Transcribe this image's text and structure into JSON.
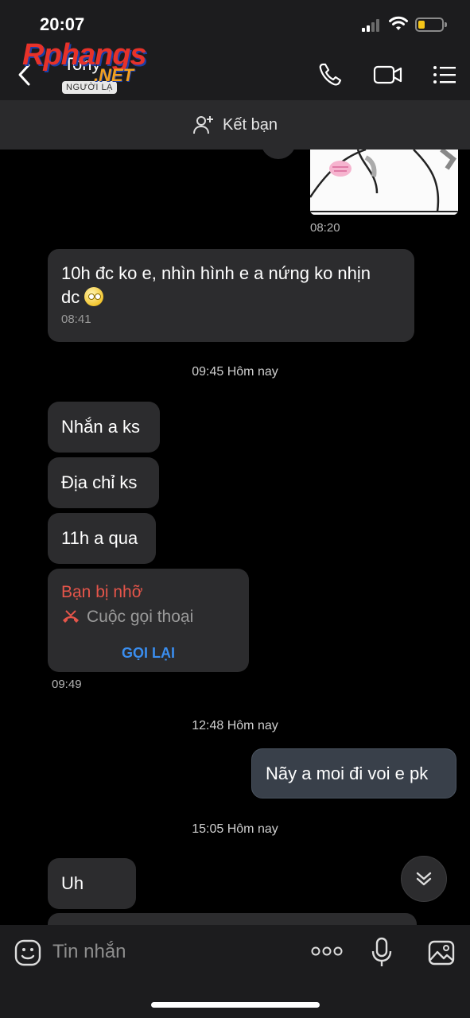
{
  "status_bar": {
    "time": "20:07"
  },
  "watermark": {
    "main": "Rphangs",
    "sub": ".NET"
  },
  "header": {
    "contact_name": "Tony",
    "stranger_tag": "NGƯỜI LẠ"
  },
  "add_friend": {
    "label": "Kết bạn"
  },
  "chat": {
    "sticker_time": "08:20",
    "messages": [
      {
        "direction": "incoming",
        "text_line1": "10h đc ko e, nhìn hình e a nứng ko nhịn",
        "text_line2": "dc",
        "time": "08:41"
      },
      {
        "direction": "incoming",
        "text": "Nhắn a ks"
      },
      {
        "direction": "incoming",
        "text": "Địa chỉ ks"
      },
      {
        "direction": "incoming",
        "text": "11h a qua"
      },
      {
        "direction": "outgoing",
        "text": "Nãy a moi đi voi e pk"
      },
      {
        "direction": "incoming",
        "text": "Uh"
      }
    ],
    "separators": [
      "09:45 Hôm nay",
      "12:48 Hôm nay",
      "15:05 Hôm nay"
    ],
    "missed_call": {
      "title": "Bạn bị nhỡ",
      "subtitle": "Cuộc gọi thoại",
      "action": "GỌI LẠI",
      "time": "09:49"
    }
  },
  "input": {
    "placeholder": "Tin nhắn"
  },
  "colors": {
    "background": "#000000",
    "bar": "#1c1c1e",
    "bubble_incoming": "#2c2c2e",
    "bubble_outgoing": "#39404a",
    "missed": "#e5554a",
    "link": "#3a8ef0"
  }
}
